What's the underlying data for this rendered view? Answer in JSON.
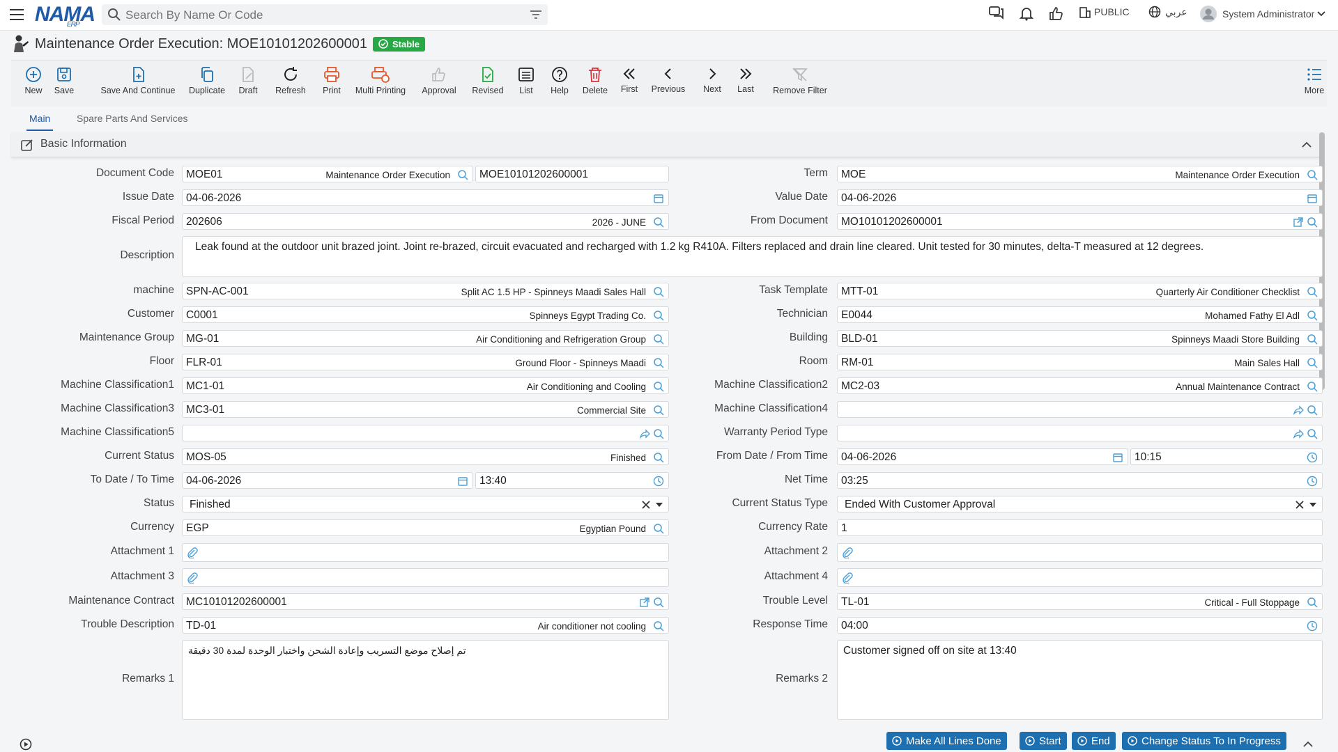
{
  "app": {
    "logo": "NAMA",
    "logo_sub": "ERP",
    "search_placeholder": "Search By Name Or Code",
    "visibility": "PUBLIC",
    "language": "عربي",
    "user": "System Administrator"
  },
  "page": {
    "title": "Maintenance Order Execution: MOE10101202600001",
    "status_badge": "Stable"
  },
  "toolbar": {
    "new": "New",
    "save": "Save",
    "save_continue": "Save And Continue",
    "duplicate": "Duplicate",
    "draft": "Draft",
    "refresh": "Refresh",
    "print": "Print",
    "multi_printing": "Multi Printing",
    "approval": "Approval",
    "revised": "Revised",
    "list": "List",
    "help": "Help",
    "delete": "Delete",
    "first": "First",
    "previous": "Previous",
    "next": "Next",
    "last": "Last",
    "remove_filter": "Remove Filter",
    "more": "More"
  },
  "tabs": {
    "main": "Main",
    "spare": "Spare Parts And Services"
  },
  "section": {
    "title": "Basic Information"
  },
  "form": {
    "document_code": {
      "label": "Document Code",
      "value": "MOE01",
      "desc": "Maintenance Order Execution",
      "code": "MOE10101202600001"
    },
    "term": {
      "label": "Term",
      "value": "MOE",
      "desc": "Maintenance Order Execution"
    },
    "issue_date": {
      "label": "Issue Date",
      "value": "04-06-2026"
    },
    "value_date": {
      "label": "Value Date",
      "value": "04-06-2026"
    },
    "fiscal_period": {
      "label": "Fiscal Period",
      "value": "202606",
      "desc": "2026 - JUNE"
    },
    "from_document": {
      "label": "From Document",
      "value": "MO10101202600001"
    },
    "description": {
      "label": "Description",
      "value": "Leak found at the outdoor unit brazed joint. Joint re-brazed, circuit evacuated and recharged with 1.2 kg R410A. Filters replaced and drain line cleared. Unit tested for 30 minutes, delta-T measured at 12 degrees."
    },
    "machine": {
      "label": "machine",
      "value": "SPN-AC-001",
      "desc": "Split AC 1.5 HP - Spinneys Maadi Sales Hall"
    },
    "task_template": {
      "label": "Task Template",
      "value": "MTT-01",
      "desc": "Quarterly Air Conditioner Checklist"
    },
    "customer": {
      "label": "Customer",
      "value": "C0001",
      "desc": "Spinneys Egypt Trading Co."
    },
    "technician": {
      "label": "Technician",
      "value": "E0044",
      "desc": "Mohamed Fathy El Adl"
    },
    "maintenance_group": {
      "label": "Maintenance Group",
      "value": "MG-01",
      "desc": "Air Conditioning and Refrigeration Group"
    },
    "building": {
      "label": "Building",
      "value": "BLD-01",
      "desc": "Spinneys Maadi Store Building"
    },
    "floor": {
      "label": "Floor",
      "value": "FLR-01",
      "desc": "Ground Floor - Spinneys Maadi"
    },
    "room": {
      "label": "Room",
      "value": "RM-01",
      "desc": "Main Sales Hall"
    },
    "mc1": {
      "label": "Machine Classification1",
      "value": "MC1-01",
      "desc": "Air Conditioning and Cooling"
    },
    "mc2": {
      "label": "Machine Classification2",
      "value": "MC2-03",
      "desc": "Annual Maintenance Contract"
    },
    "mc3": {
      "label": "Machine Classification3",
      "value": "MC3-01",
      "desc": "Commercial Site"
    },
    "mc4": {
      "label": "Machine Classification4",
      "value": ""
    },
    "mc5": {
      "label": "Machine Classification5",
      "value": ""
    },
    "warranty": {
      "label": "Warranty Period Type",
      "value": ""
    },
    "current_status": {
      "label": "Current Status",
      "value": "MOS-05",
      "desc": "Finished"
    },
    "from_date_time": {
      "label": "From Date / From Time",
      "date": "04-06-2026",
      "time": "10:15"
    },
    "to_date_time": {
      "label": "To Date / To Time",
      "date": "04-06-2026",
      "time": "13:40"
    },
    "net_time": {
      "label": "Net Time",
      "value": "03:25"
    },
    "status": {
      "label": "Status",
      "value": "Finished"
    },
    "current_status_type": {
      "label": "Current Status Type",
      "value": "Ended With Customer Approval"
    },
    "currency": {
      "label": "Currency",
      "value": "EGP",
      "desc": "Egyptian Pound"
    },
    "currency_rate": {
      "label": "Currency Rate",
      "value": "1"
    },
    "attachment1": {
      "label": "Attachment 1"
    },
    "attachment2": {
      "label": "Attachment 2"
    },
    "attachment3": {
      "label": "Attachment 3"
    },
    "attachment4": {
      "label": "Attachment 4"
    },
    "maintenance_contract": {
      "label": "Maintenance Contract",
      "value": "MC10101202600001"
    },
    "trouble_level": {
      "label": "Trouble Level",
      "value": "TL-01",
      "desc": "Critical - Full Stoppage"
    },
    "trouble_description": {
      "label": "Trouble Description",
      "value": "TD-01",
      "desc": "Air conditioner not cooling"
    },
    "response_time": {
      "label": "Response Time",
      "value": "04:00"
    },
    "remarks1": {
      "label": "Remarks 1",
      "value": "تم إصلاح موضع التسريب وإعادة الشحن واختبار الوحدة لمدة 30 دقيقة"
    },
    "remarks2": {
      "label": "Remarks 2",
      "value": "Customer signed off on site at 13:40"
    }
  },
  "actions": {
    "make_all_done": "Make All Lines Done",
    "start": "Start",
    "end": "End",
    "change_status": "Change Status To In Progress"
  },
  "colors": {
    "accent": "#1e5aa8",
    "stable": "#27a844",
    "button": "#1e6fb0"
  }
}
